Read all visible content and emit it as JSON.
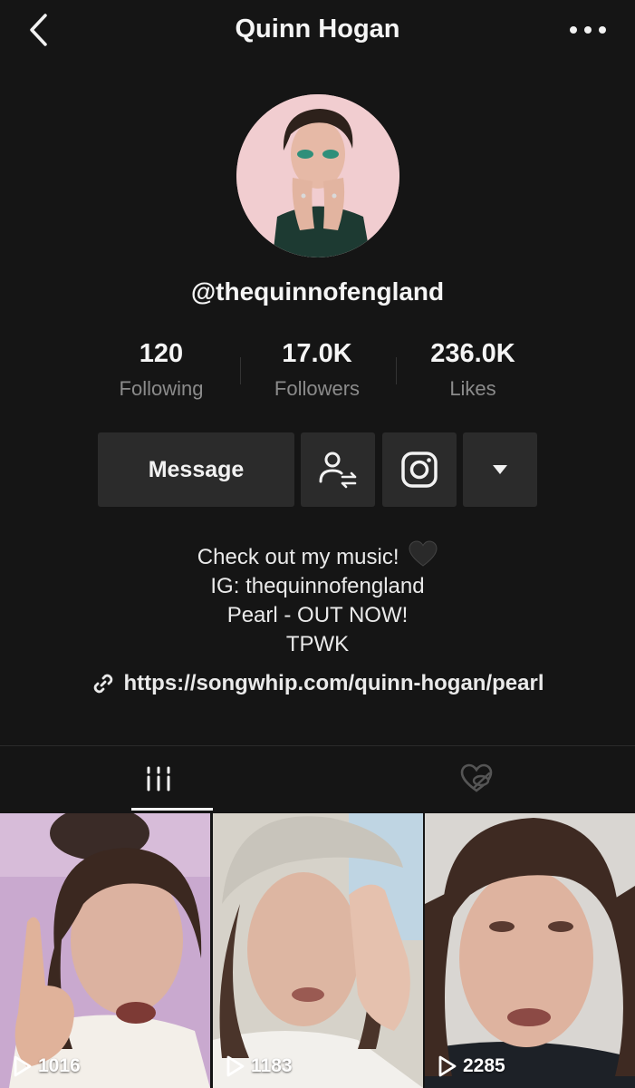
{
  "header": {
    "title": "Quinn Hogan",
    "back_icon": "chevron-left-icon",
    "more_icon": "ellipsis-icon"
  },
  "profile": {
    "handle": "@thequinnofengland",
    "avatar_icon": "avatar-photo"
  },
  "stats": [
    {
      "value": "120",
      "label": "Following"
    },
    {
      "value": "17.0K",
      "label": "Followers"
    },
    {
      "value": "236.0K",
      "label": "Likes"
    }
  ],
  "actions": {
    "message_label": "Message",
    "follow_icon": "user-swap-icon",
    "instagram_icon": "instagram-icon",
    "more_icon": "caret-down-icon"
  },
  "bio": {
    "lines": [
      "Check out my music!",
      "IG: thequinnofengland",
      "Pearl - OUT NOW!",
      "TPWK"
    ],
    "emoji": "black-heart-icon"
  },
  "link": {
    "text": "https://songwhip.com/quinn-hogan/pearl",
    "icon": "link-icon"
  },
  "tabs": [
    {
      "name": "videos",
      "icon": "grid-bars-icon",
      "active": true
    },
    {
      "name": "liked",
      "icon": "heart-hidden-icon",
      "active": false
    }
  ],
  "videos": [
    {
      "views": "1016"
    },
    {
      "views": "1183"
    },
    {
      "views": "2285"
    }
  ],
  "colors": {
    "background": "#151515",
    "button": "#2b2b2b",
    "muted_text": "#8b8b8b"
  }
}
